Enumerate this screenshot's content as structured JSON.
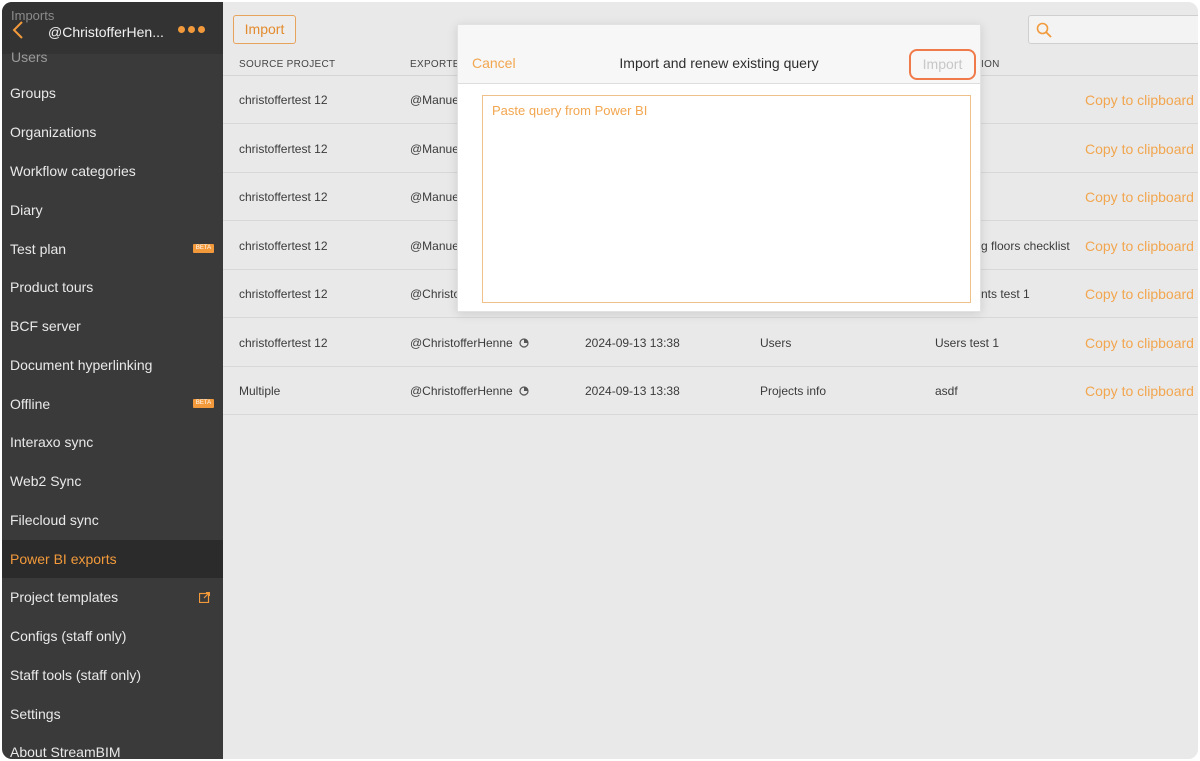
{
  "sidebar": {
    "ghost_title": "Imports",
    "back_icon": "chevron-left-icon",
    "user": "@ChristofferHen...",
    "more_icon": "more-dots-icon",
    "users_label": "Users",
    "items": [
      {
        "label": "Groups"
      },
      {
        "label": "Organizations"
      },
      {
        "label": "Workflow categories"
      },
      {
        "label": "Diary"
      },
      {
        "label": "Test plan",
        "badge": "BETA"
      },
      {
        "label": "Product tours"
      },
      {
        "label": "BCF server"
      },
      {
        "label": "Document hyperlinking"
      },
      {
        "label": "Offline",
        "badge": "BETA"
      },
      {
        "label": "Interaxo sync"
      },
      {
        "label": "Web2 Sync"
      },
      {
        "label": "Filecloud sync"
      },
      {
        "label": "Power BI exports",
        "active": true
      },
      {
        "label": "Project templates",
        "icon": "external-link-icon"
      },
      {
        "label": "Configs (staff only)"
      },
      {
        "label": "Staff tools (staff only)"
      },
      {
        "label": "Settings"
      },
      {
        "label": "About StreamBIM"
      }
    ],
    "accent_color": "#f29a3b"
  },
  "toolbar": {
    "import_label": "Import",
    "search_placeholder": "",
    "search_icon": "search-icon"
  },
  "table": {
    "headers": {
      "source_project": "SOURCE PROJECT",
      "exported": "EXPORTED",
      "description_partial": "ION"
    },
    "copy_label": "Copy to clipboard",
    "rows": [
      {
        "source": "christoffertest 12",
        "exported_by": "@Manuel",
        "date": "",
        "type": "",
        "name": ""
      },
      {
        "source": "christoffertest 12",
        "exported_by": "@Manuel",
        "date": "",
        "type": "",
        "name": ""
      },
      {
        "source": "christoffertest 12",
        "exported_by": "@Manuel",
        "date": "",
        "type": "",
        "name": ""
      },
      {
        "source": "christoffertest 12",
        "exported_by": "@Manuel",
        "date": "",
        "type": "",
        "name": "g floors checklist"
      },
      {
        "source": "christoffertest 12",
        "exported_by": "@Christo",
        "date": "",
        "type": "",
        "name": "nts test 1"
      },
      {
        "source": "christoffertest 12",
        "exported_by": "@ChristofferHenne",
        "date": "2024-09-13 13:38",
        "type": "Users",
        "name": "Users test 1"
      },
      {
        "source": "Multiple",
        "exported_by": "@ChristofferHenne",
        "date": "2024-09-13 13:38",
        "type": "Projects info",
        "name": "asdf"
      }
    ]
  },
  "modal": {
    "cancel_label": "Cancel",
    "title": "Import and renew existing query",
    "import_label": "Import",
    "placeholder": "Paste query from Power BI",
    "highlight_color": "#f07a4a"
  }
}
